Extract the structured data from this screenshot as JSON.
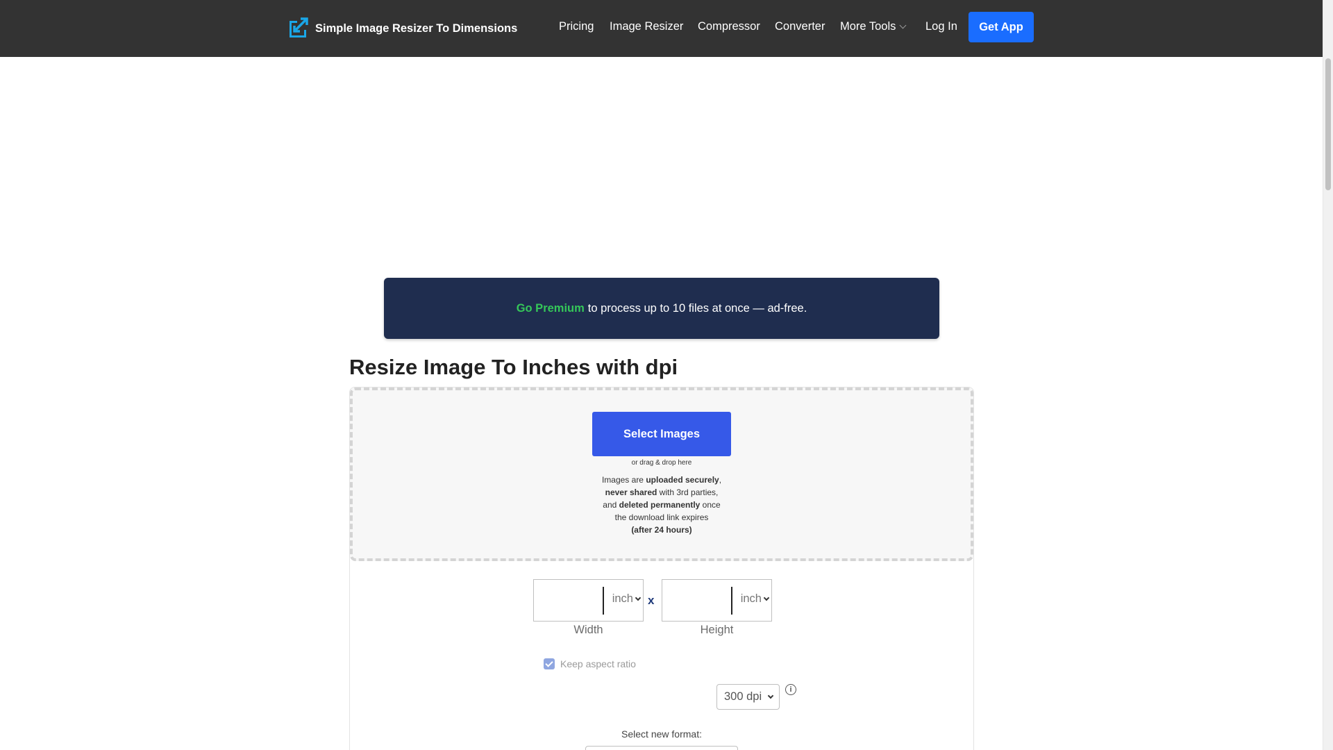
{
  "header": {
    "brand_name": "Simple Image Resizer To Dimensions",
    "nav": {
      "pricing": "Pricing",
      "image_resizer": "Image Resizer",
      "compressor": "Compressor",
      "converter": "Converter",
      "more_tools": "More Tools",
      "log_in": "Log In",
      "get_app": "Get App"
    }
  },
  "banner": {
    "go_premium": "Go Premium",
    "text": "to process up to 10 files at once — ad-free."
  },
  "main": {
    "title": "Resize Image To Inches with dpi",
    "upload": {
      "button": "Select Images",
      "hint": "or drag & drop here",
      "privacy": {
        "p1": "Images are ",
        "b1": "uploaded securely",
        "p2": ",",
        "b2": "never shared",
        "p3": " with 3rd parties,",
        "p4": "and ",
        "b3": "deleted permanently",
        "p5": " once",
        "p6": "the download link expires",
        "b4": "(after 24 hours)"
      }
    },
    "dimensions": {
      "width_value": "",
      "height_value": "",
      "width_unit": "inch",
      "height_unit": "inch",
      "separator": "x",
      "width_label": "Width",
      "height_label": "Height"
    },
    "aspect_ratio": {
      "label": "Keep aspect ratio",
      "checked": true
    },
    "dpi": {
      "value": "300 dpi"
    },
    "format": {
      "label": "Select new format:"
    }
  },
  "colors": {
    "topbar": "#333333",
    "get_app": "#1a6dff",
    "select_button": "#3659e8",
    "banner": "#1f2d4f",
    "go_premium": "#35c759"
  }
}
